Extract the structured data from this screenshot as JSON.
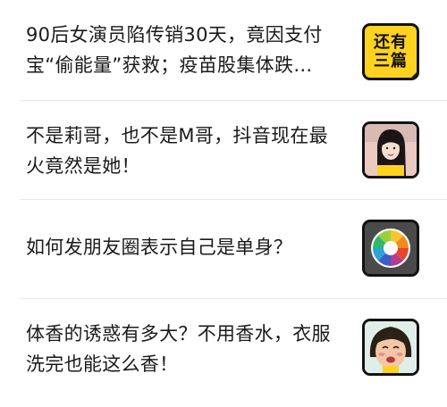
{
  "articles": [
    {
      "title": "90后女演员陷传销30天，竟因支付宝“偷能量”获救；疫苗股集体跌…",
      "thumb": {
        "type": "badge",
        "text_line1": "还有",
        "text_line2": "三篇",
        "icon": "more-articles-badge-icon",
        "color": "#ffd21f"
      }
    },
    {
      "title": "不是莉哥，也不是M哥，抖音现在最火竟然是她！",
      "thumb": {
        "type": "photo",
        "icon": "woman-portrait-icon"
      }
    },
    {
      "title": "如何发朋友圈表示自己是单身？",
      "thumb": {
        "type": "icon",
        "icon": "moments-aperture-icon"
      }
    },
    {
      "title": "体香的诱惑有多大？不用香水，衣服洗完也能这么香！",
      "thumb": {
        "type": "illustration",
        "icon": "cartoon-face-icon"
      }
    }
  ]
}
